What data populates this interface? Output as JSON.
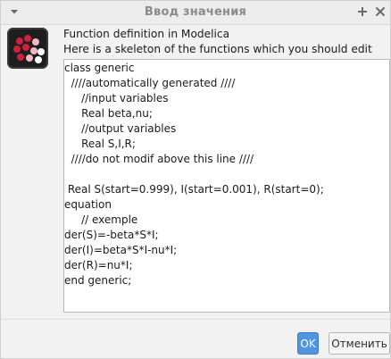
{
  "window": {
    "title": "Ввод значения"
  },
  "dialog": {
    "heading": "Function definition in Modelica",
    "subheading": "Here is a skeleton of the functions which you should edit",
    "code_lines": [
      "class generic",
      "  ////automatically generated ////",
      "     //input variables",
      "     Real beta,nu;",
      "     //output variables",
      "     Real S,I,R;",
      "  ////do not modif above this line ////",
      "",
      " Real S(start=0.999), I(start=0.001), R(start=0);",
      "equation",
      "     // exemple",
      "der(S)=-beta*S*I;",
      "der(I)=beta*S*I-nu*I;",
      "der(R)=nu*I;",
      "end generic;"
    ]
  },
  "buttons": {
    "ok_label": "OK",
    "cancel_label": "Отменить"
  },
  "colors": {
    "accent": "#5294e2",
    "icon_bg": "#1e1e1e",
    "icon_red": "#d0203a",
    "icon_pink": "#f2b8c2"
  },
  "icons": {
    "window_menu": "chevron-down-icon",
    "maximize": "plus-icon",
    "close": "close-icon",
    "app": "scilab-logo-icon"
  }
}
